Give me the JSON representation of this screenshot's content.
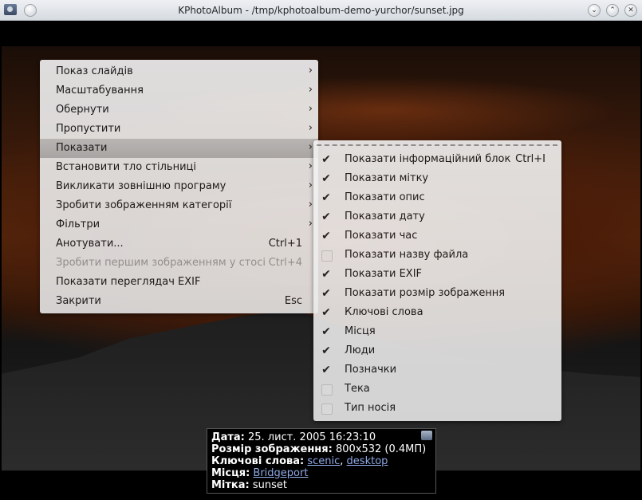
{
  "window": {
    "title": "KPhotoAlbum - /tmp/kphotoalbum-demo-yurchor/sunset.jpg"
  },
  "menu": {
    "items": [
      {
        "label": "Показ слайдів",
        "shortcut": "",
        "submenu": true
      },
      {
        "label": "Масштабування",
        "shortcut": "",
        "submenu": true
      },
      {
        "label": "Обернути",
        "shortcut": "",
        "submenu": true
      },
      {
        "label": "Пропустити",
        "shortcut": "",
        "submenu": true
      },
      {
        "label": "Показати",
        "shortcut": "",
        "submenu": true
      },
      {
        "label": "Встановити тло стільниці",
        "shortcut": "",
        "submenu": true
      },
      {
        "label": "Викликати зовнішню програму",
        "shortcut": "",
        "submenu": true
      },
      {
        "label": "Зробити зображенням категорії",
        "shortcut": "",
        "submenu": true
      },
      {
        "label": "Фільтри",
        "shortcut": "",
        "submenu": true
      },
      {
        "label": "Анотувати...",
        "shortcut": "Ctrl+1",
        "submenu": false
      },
      {
        "label": "Зробити першим зображенням у стосі",
        "shortcut": "Ctrl+4",
        "submenu": false
      },
      {
        "label": "Показати переглядач EXIF",
        "shortcut": "",
        "submenu": false
      },
      {
        "label": "Закрити",
        "shortcut": "Esc",
        "submenu": false
      }
    ],
    "arrow": "›"
  },
  "submenu": {
    "items": [
      {
        "label": "Показати інформаційний блок",
        "shortcut": "Ctrl+I",
        "checked": true
      },
      {
        "label": "Показати мітку",
        "shortcut": "",
        "checked": true
      },
      {
        "label": "Показати опис",
        "shortcut": "",
        "checked": true
      },
      {
        "label": "Показати дату",
        "shortcut": "",
        "checked": true
      },
      {
        "label": "Показати час",
        "shortcut": "",
        "checked": true
      },
      {
        "label": "Показати назву файла",
        "shortcut": "",
        "checked": false
      },
      {
        "label": "Показати EXIF",
        "shortcut": "",
        "checked": true
      },
      {
        "label": "Показати розмір зображення",
        "shortcut": "",
        "checked": true
      },
      {
        "label": "Ключові слова",
        "shortcut": "",
        "checked": true
      },
      {
        "label": "Місця",
        "shortcut": "",
        "checked": true
      },
      {
        "label": "Люди",
        "shortcut": "",
        "checked": true
      },
      {
        "label": "Позначки",
        "shortcut": "",
        "checked": true
      },
      {
        "label": "Тека",
        "shortcut": "",
        "checked": false
      },
      {
        "label": "Тип носія",
        "shortcut": "",
        "checked": false
      }
    ],
    "check_glyph": "✔"
  },
  "info": {
    "date_label": "Дата:",
    "date_value": "25. лист. 2005 16:23:10",
    "size_label": "Розмір зображення:",
    "size_value": "800x532 (0.4МП)",
    "keywords_label": "Ключові слова:",
    "keyword_1": "scenic",
    "keyword_sep": ", ",
    "keyword_2": "desktop",
    "places_label": "Місця:",
    "place_1": "Bridgeport",
    "tag_label": "Мітка:",
    "tag_value": "sunset"
  }
}
